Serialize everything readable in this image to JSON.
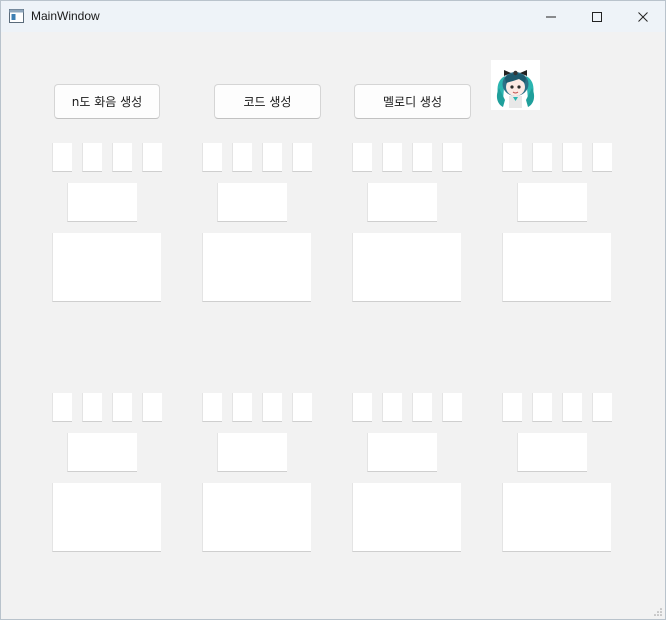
{
  "window": {
    "title": "MainWindow",
    "controls": {
      "minimize": "minimize",
      "maximize": "maximize",
      "close": "close"
    }
  },
  "toolbar": {
    "buttons": [
      {
        "label": "n도 화음 생성"
      },
      {
        "label": "코드 생성"
      },
      {
        "label": "멜로디 생성"
      }
    ]
  },
  "avatar": {
    "alt": "character image"
  },
  "colors": {
    "window_bg": "#f2f2f2",
    "titlebar_bg": "#eef3f8",
    "field_bg": "#ffffff",
    "avatar_accent": "#2bb5b0"
  },
  "groups": {
    "rows": 2,
    "columns": 4,
    "small_fields_per_group": 4,
    "medium_fields_per_group": 1,
    "large_fields_per_group": 1
  }
}
